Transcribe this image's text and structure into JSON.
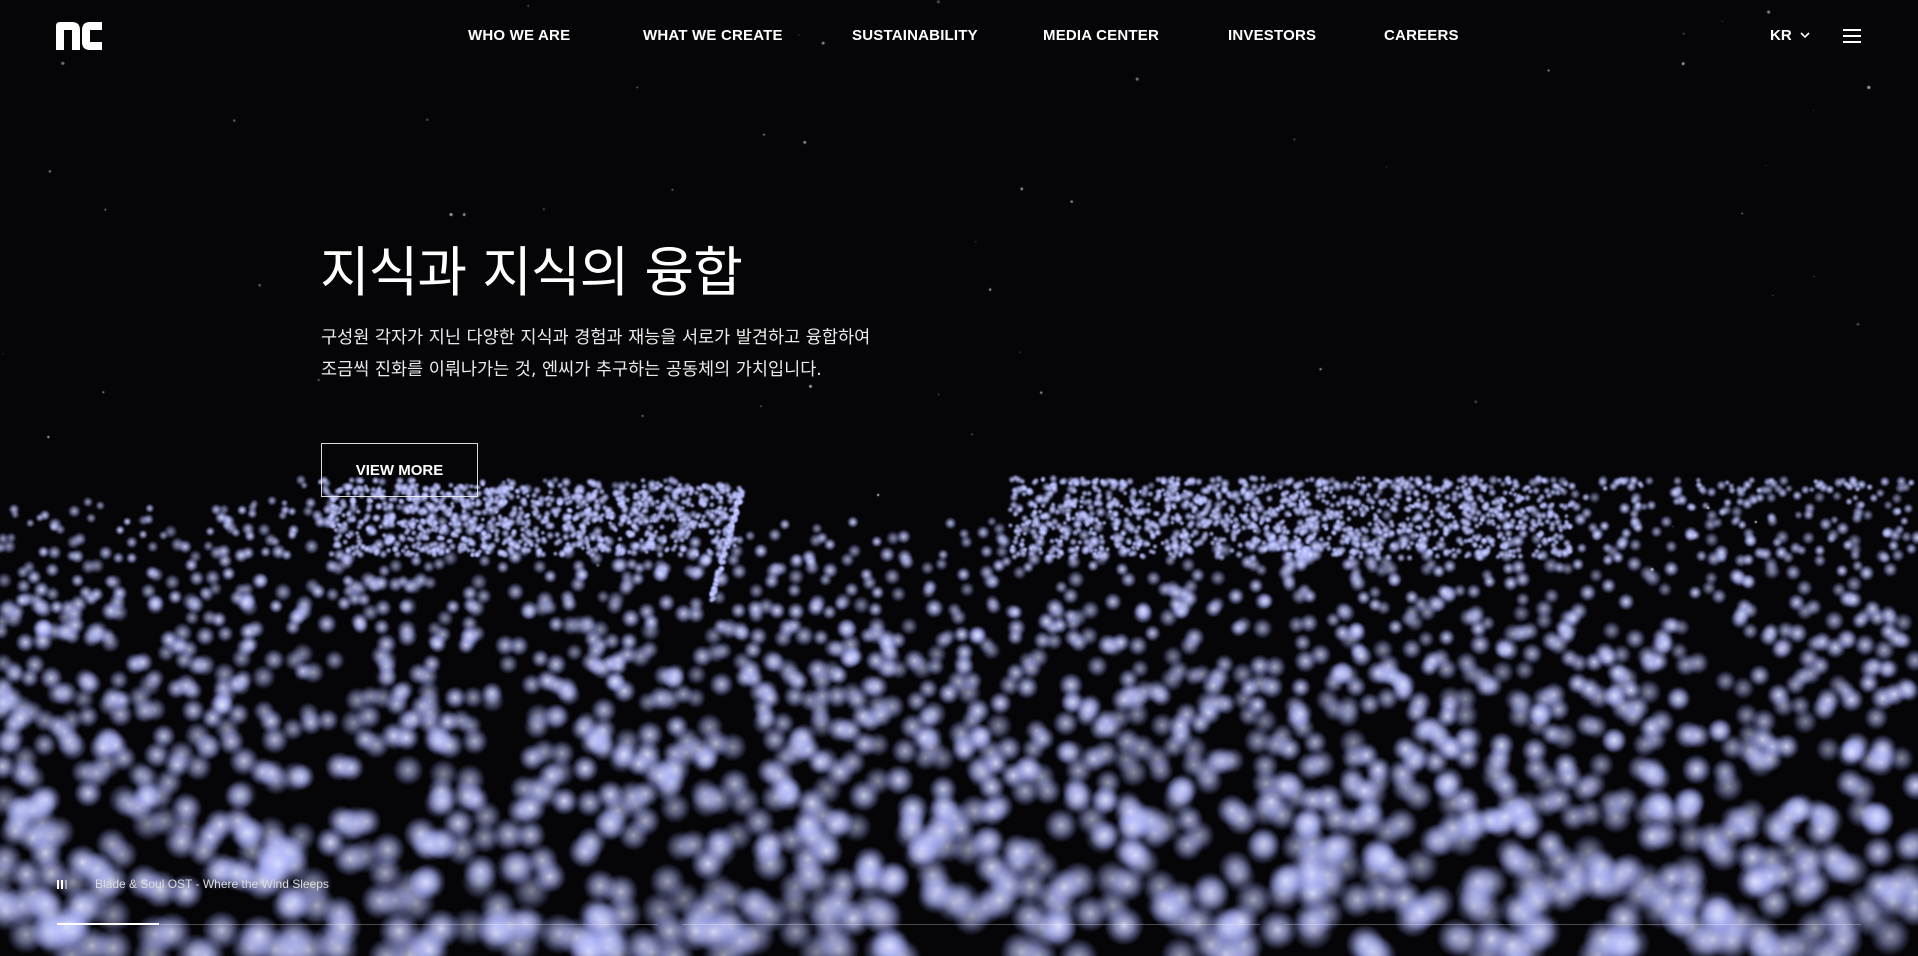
{
  "header": {
    "logo_text": "nc",
    "nav": [
      {
        "label": "WHO WE ARE"
      },
      {
        "label": "WHAT WE CREATE"
      },
      {
        "label": "SUSTAINABILITY"
      },
      {
        "label": "MEDIA CENTER"
      },
      {
        "label": "INVESTORS"
      },
      {
        "label": "CAREERS"
      }
    ],
    "language": "KR",
    "language_icon": "chevron-down-icon",
    "menu_icon": "hamburger-menu-icon"
  },
  "hero": {
    "title": "지식과 지식의 융합",
    "description_line1": "구성원 각자가 지닌 다양한 지식과 경험과 재능을 서로가 발견하고 융합하여",
    "description_line2": "조금씩 진화를 이뤄나가는 것, 엔씨가 추구하는 공동체의 가치입니다.",
    "button_label": "VIEW MORE"
  },
  "player": {
    "icon": "pause-icon",
    "track": "Blade & Soul OST - Where the Wind Sleeps"
  },
  "slides": {
    "count": 3,
    "active_index": 0,
    "active_progress": 0.17
  },
  "colors": {
    "background": "#050508",
    "particle": "#c8ccff",
    "text": "#ffffff"
  }
}
